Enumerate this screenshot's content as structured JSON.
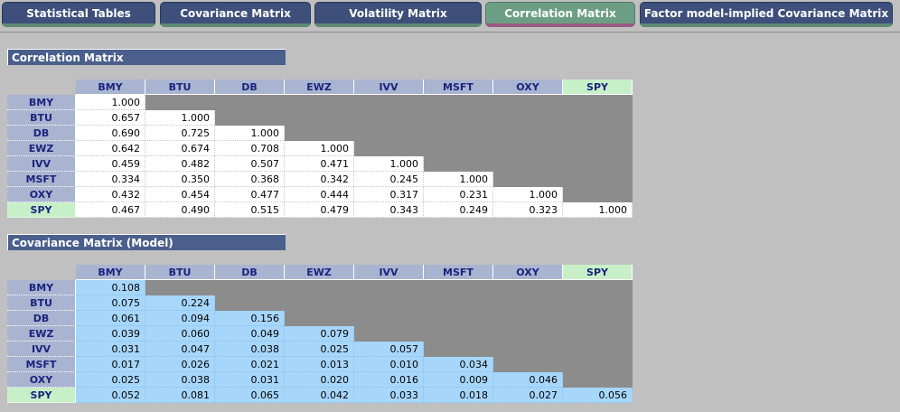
{
  "tabs": [
    {
      "label": "Statistical Tables",
      "active": false
    },
    {
      "label": "Covariance Matrix",
      "active": false
    },
    {
      "label": "Volatility Matrix",
      "active": false
    },
    {
      "label": "Correlation Matrix",
      "active": true
    },
    {
      "label": "Factor model-implied Covariance Matrix",
      "active": false
    }
  ],
  "colors": {
    "tab": "#3d4f7a",
    "tab_active": "#6b9e85",
    "header": "#a9b4d0",
    "header_spy": "#c8f0c8",
    "gray_cell": "#8c8c8c",
    "blue_cell": "#a7d6fb"
  },
  "tickers": [
    "BMY",
    "BTU",
    "DB",
    "EWZ",
    "IVV",
    "MSFT",
    "OXY",
    "SPY"
  ],
  "correlation": {
    "title": "Correlation Matrix",
    "rows": [
      [
        "1.000"
      ],
      [
        "0.657",
        "1.000"
      ],
      [
        "0.690",
        "0.725",
        "1.000"
      ],
      [
        "0.642",
        "0.674",
        "0.708",
        "1.000"
      ],
      [
        "0.459",
        "0.482",
        "0.507",
        "0.471",
        "1.000"
      ],
      [
        "0.334",
        "0.350",
        "0.368",
        "0.342",
        "0.245",
        "1.000"
      ],
      [
        "0.432",
        "0.454",
        "0.477",
        "0.444",
        "0.317",
        "0.231",
        "1.000"
      ],
      [
        "0.467",
        "0.490",
        "0.515",
        "0.479",
        "0.343",
        "0.249",
        "0.323",
        "1.000"
      ]
    ]
  },
  "covariance": {
    "title": "Covariance Matrix (Model)",
    "rows": [
      [
        "0.108"
      ],
      [
        "0.075",
        "0.224"
      ],
      [
        "0.061",
        "0.094",
        "0.156"
      ],
      [
        "0.039",
        "0.060",
        "0.049",
        "0.079"
      ],
      [
        "0.031",
        "0.047",
        "0.038",
        "0.025",
        "0.057"
      ],
      [
        "0.017",
        "0.026",
        "0.021",
        "0.013",
        "0.010",
        "0.034"
      ],
      [
        "0.025",
        "0.038",
        "0.031",
        "0.020",
        "0.016",
        "0.009",
        "0.046"
      ],
      [
        "0.052",
        "0.081",
        "0.065",
        "0.042",
        "0.033",
        "0.018",
        "0.027",
        "0.056"
      ]
    ]
  }
}
